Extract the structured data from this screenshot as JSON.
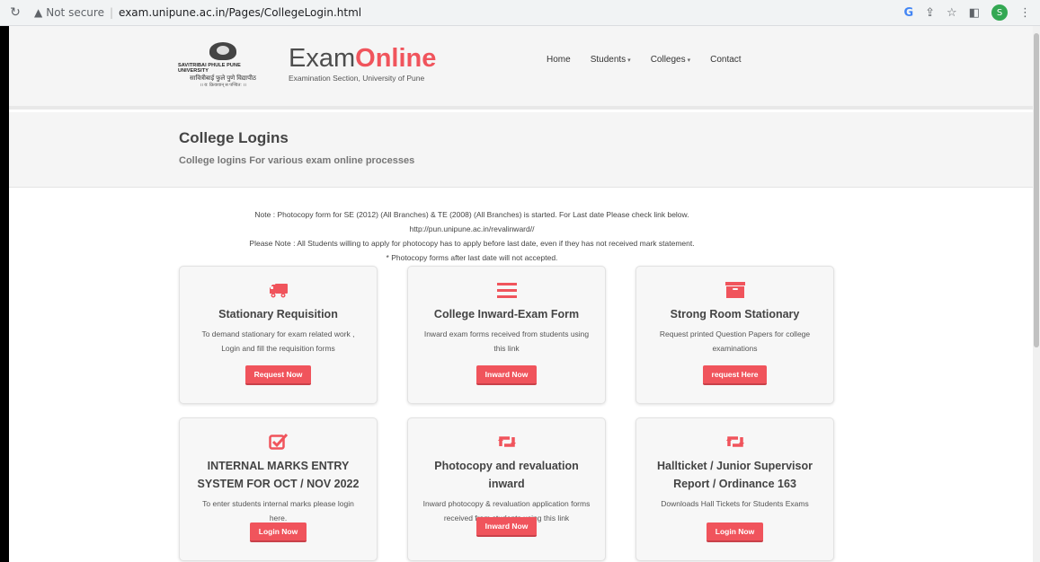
{
  "browser": {
    "security_label": "Not secure",
    "url": "exam.unipune.ac.in/Pages/CollegeLogin.html",
    "profile_initial": "S"
  },
  "header": {
    "logo_line1": "SAVITRIBAI PHULE PUNE UNIVERSITY",
    "logo_line2": "सावित्रीबाई फुले पुणे विद्यापीठ",
    "logo_line3": "।। य: क्रियावान् स पण्डित: ।।",
    "brand_plain": "Exam",
    "brand_accent": "Online",
    "brand_subtitle": "Examination Section, University of Pune",
    "nav": [
      "Home",
      "Students",
      "Colleges",
      "Contact"
    ]
  },
  "page": {
    "title": "College Logins",
    "subtitle": "College logins For various exam online processes"
  },
  "notes": [
    "Note : Photocopy form for SE (2012) (All Branches) & TE (2008) (All Branches) is started. For Last date Please check link below.",
    "http://pun.unipune.ac.in/revalinward//",
    "Please Note : All Students willing to apply for photocopy has to apply before last date, even if they has not received mark statement.",
    "* Photocopy forms after last date will not accepted."
  ],
  "cards": [
    {
      "icon": "truck-icon",
      "title": "Stationary Requisition",
      "desc": "To demand stationary for exam related work , Login and fill the requisition forms",
      "button": "Request Now"
    },
    {
      "icon": "list-icon",
      "title": "College Inward-Exam Form",
      "desc": "Inward exam forms received from students using this link",
      "button": "Inward Now"
    },
    {
      "icon": "archive-icon",
      "title": "Strong Room Stationary",
      "desc": "Request printed Question Papers for college examinations",
      "button": "request Here"
    },
    {
      "icon": "checkbox-icon",
      "title": "INTERNAL MARKS ENTRY SYSTEM FOR OCT / NOV 2022",
      "desc": "To enter students internal marks please login here.",
      "button": "Login Now"
    },
    {
      "icon": "retweet-icon",
      "title": "Photocopy and revaluation inward",
      "desc": "Inward photocopy & revaluation application forms received from students using this link",
      "button": "Inward Now"
    },
    {
      "icon": "retweet-icon",
      "title": "Hallticket / Junior Supervisor Report / Ordinance 163",
      "desc": "Downloads Hall Tickets for Students Exams",
      "button": "Login Now"
    }
  ],
  "colors": {
    "accent": "#f0545c"
  }
}
